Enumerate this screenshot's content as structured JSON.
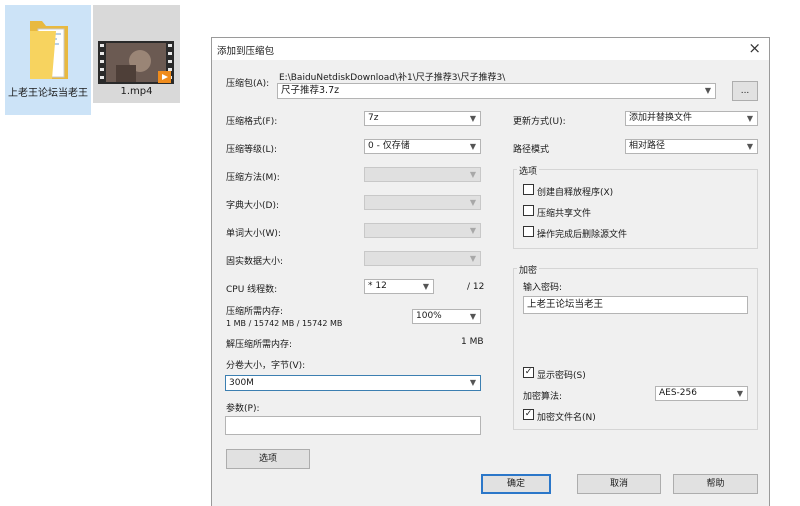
{
  "desktop": {
    "folder_label": "上老王论坛当老王",
    "file_label": "1.mp4"
  },
  "dialog": {
    "title": "添加到压缩包",
    "close_glyph": "×",
    "archive": {
      "label": "压缩包(A):",
      "path": "E:\\BaiduNetdiskDownload\\补1\\尺子推荐3\\尺子推荐3\\",
      "name": "尺子推荐3.7z",
      "browse_label": "..."
    },
    "format": {
      "label": "压缩格式(F):",
      "value": "7z"
    },
    "level": {
      "label": "压缩等级(L):",
      "value": "0 - 仅存储"
    },
    "method": {
      "label": "压缩方法(M):",
      "value": ""
    },
    "dict": {
      "label": "字典大小(D):",
      "value": ""
    },
    "word": {
      "label": "单词大小(W):",
      "value": ""
    },
    "solid": {
      "label": "固实数据大小:",
      "value": ""
    },
    "cpu": {
      "label": "CPU 线程数:",
      "value": "* 12",
      "max": "/ 12"
    },
    "mem_compress": {
      "label": "压缩所需内存:",
      "detail": "1 MB / 15742 MB / 15742 MB",
      "value": "100%"
    },
    "mem_decompress": {
      "label": "解压缩所需内存:",
      "value": "1 MB"
    },
    "volume": {
      "label": "分卷大小，字节(V):",
      "value": "300M"
    },
    "params": {
      "label": "参数(P):",
      "value": ""
    },
    "options_button": "选项",
    "update": {
      "label": "更新方式(U):",
      "value": "添加并替换文件"
    },
    "pathmode": {
      "label": "路径模式",
      "value": "相对路径"
    },
    "options_group": {
      "title": "选项",
      "sfx": {
        "label": "创建自释放程序(X)",
        "checked": false
      },
      "shared": {
        "label": "压缩共享文件",
        "checked": false
      },
      "delete": {
        "label": "操作完成后删除源文件",
        "checked": false
      }
    },
    "encrypt_group": {
      "title": "加密",
      "pw_label": "输入密码:",
      "pw_value": "上老王论坛当老王",
      "show_pw": {
        "label": "显示密码(S)",
        "checked": true
      },
      "method_label": "加密算法:",
      "method_value": "AES-256",
      "enc_names": {
        "label": "加密文件名(N)",
        "checked": true
      }
    },
    "buttons": {
      "ok": "确定",
      "cancel": "取消",
      "help": "帮助"
    },
    "check_glyph": "✓"
  }
}
